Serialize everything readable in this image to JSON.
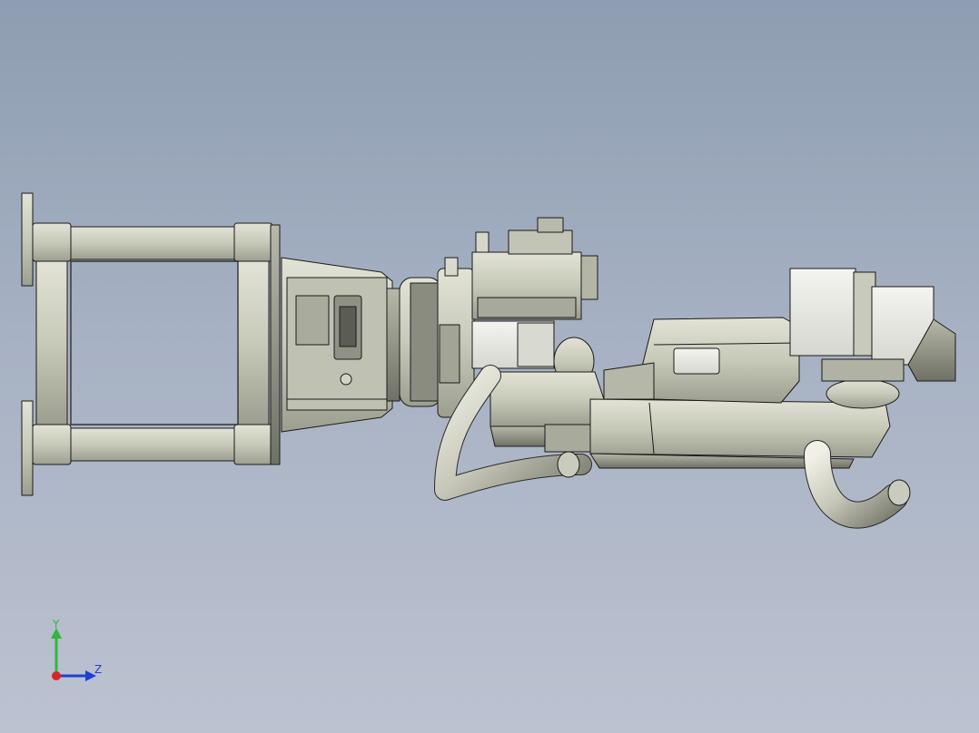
{
  "viewport": {
    "background_top": "#8e9db1",
    "background_bottom": "#bcc2d0",
    "model_color": "#c9cbbd",
    "edge_color": "#1a1a1a"
  },
  "triad": {
    "y_label": "Y",
    "z_label": "Z",
    "y_color": "#2fb83a",
    "z_color": "#1f3fd8",
    "x_color": "#d8242a"
  }
}
